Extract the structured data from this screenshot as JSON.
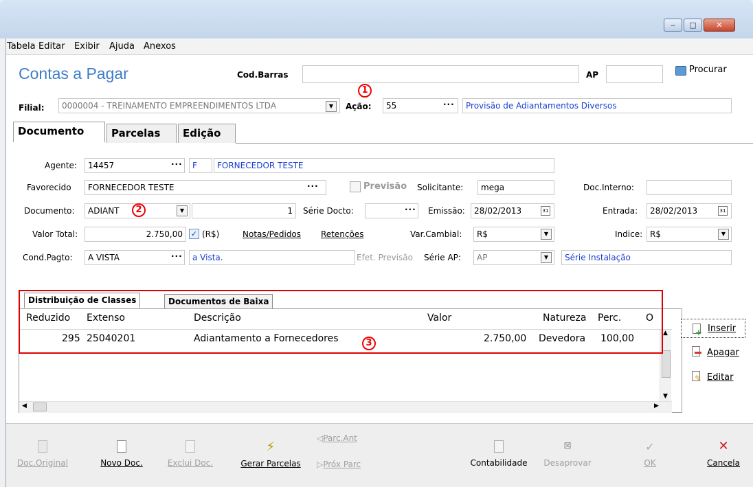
{
  "window": {
    "min_symbol": "‒",
    "max_symbol": "□",
    "close_symbol": "✕"
  },
  "menu": {
    "items": [
      "Tabela",
      "Editar",
      "Exibir",
      "Ajuda",
      "Anexos"
    ]
  },
  "header": {
    "title": "Contas a Pagar",
    "codbarras_label": "Cod.Barras",
    "codbarras_value": "",
    "ap_label": "AP",
    "ap_value": "",
    "procurar_label": "Procurar",
    "filial_label": "Filial:",
    "filial_value": "0000004 - TREINAMENTO EMPREENDIMENTOS LTDA",
    "acao_label": "Ação:",
    "acao_value": "55",
    "acao_desc": "Provisão de Adiantamentos Diversos",
    "annot1": "1"
  },
  "tabs": [
    "Documento",
    "Parcelas",
    "Edição"
  ],
  "form": {
    "agente_label": "Agente:",
    "agente_value": "14457",
    "agente_tipo": "F",
    "agente_nome": "FORNECEDOR TESTE",
    "favorecido_label": "Favorecido",
    "favorecido_value": "FORNECEDOR TESTE",
    "previsao_label": "Previsão",
    "solicitante_label": "Solicitante:",
    "solicitante_value": "mega",
    "docinterno_label": "Doc.Interno:",
    "docinterno_value": "",
    "documento_label": "Documento:",
    "documento_value": "ADIANT",
    "annot2": "2",
    "documento_num": "1",
    "seriedocto_label": "Série Docto:",
    "seriedocto_value": "",
    "emissao_label": "Emissão:",
    "emissao_value": "28/02/2013",
    "entrada_label": "Entrada:",
    "entrada_value": "28/02/2013",
    "valortotal_label": "Valor Total:",
    "valortotal_value": "2.750,00",
    "rs_label": "(R$)",
    "notas_label": "Notas/Pedidos",
    "retencoes_label": "Retenções",
    "varcambial_label": "Var.Cambial:",
    "varcambial_value": "R$",
    "indice_label": "Indice:",
    "indice_value": "R$",
    "condpagto_label": "Cond.Pagto:",
    "condpagto_value": "A VISTA",
    "condpagto_desc": "a Vista.",
    "efetprevisao_label": "Efet. Previsão",
    "serieap_label": "Série AP:",
    "serieap_value": "AP",
    "serieap_desc": "Série Instalação"
  },
  "grid": {
    "tabs": [
      "Distribuição de Classes",
      "Documentos de Baixa"
    ],
    "columns": [
      "Reduzido",
      "Extenso",
      "Descrição",
      "Valor",
      "Natureza",
      "Perc.",
      "O"
    ],
    "rows": [
      {
        "reduzido": "295",
        "extenso": "25040201",
        "descricao": "Adiantamento a Fornecedores",
        "valor": "2.750,00",
        "natureza": "Devedora",
        "perc": "100,00"
      }
    ],
    "annot3": "3",
    "buttons": {
      "inserir": "Inserir",
      "apagar": "Apagar",
      "editar": "Editar"
    }
  },
  "toolbar": {
    "doc_original": "Doc.Original",
    "novo_doc": "Novo Doc.",
    "exclui_doc": "Exclui Doc.",
    "gerar_parcelas": "Gerar Parcelas",
    "parc_ant": "Parc.Ant",
    "prox_parc": "Próx Parc",
    "contabilidade": "Contabilidade",
    "desaprovar": "Desaprovar",
    "ok": "OK",
    "cancela": "Cancela"
  }
}
